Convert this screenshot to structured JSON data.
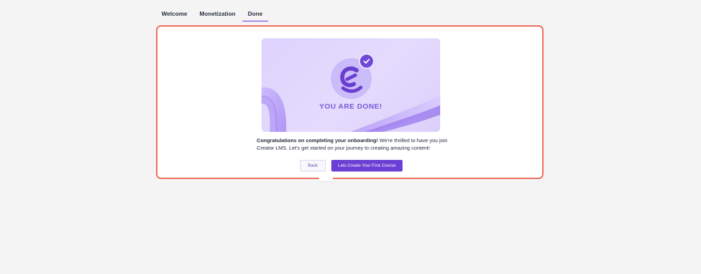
{
  "tabs": [
    {
      "label": "Welcome",
      "active": false
    },
    {
      "label": "Monetization",
      "active": false
    },
    {
      "label": "Done",
      "active": true
    }
  ],
  "banner": {
    "title": "YOU ARE DONE!",
    "logo_icon": "creator-lms-logo-icon",
    "badge_icon": "checkmark-icon"
  },
  "message": {
    "bold": "Congratulations on completing your onboarding!",
    "rest": " We're thrilled to have you join Creator LMS. Let's get started on your journey to creating amazing content!"
  },
  "actions": {
    "back_label": "Back",
    "primary_label": "Lets Create Your First Course"
  },
  "colors": {
    "accent": "#6b3fd3",
    "highlight_border": "#ef6a58",
    "tab_underline": "#a48ae8"
  }
}
